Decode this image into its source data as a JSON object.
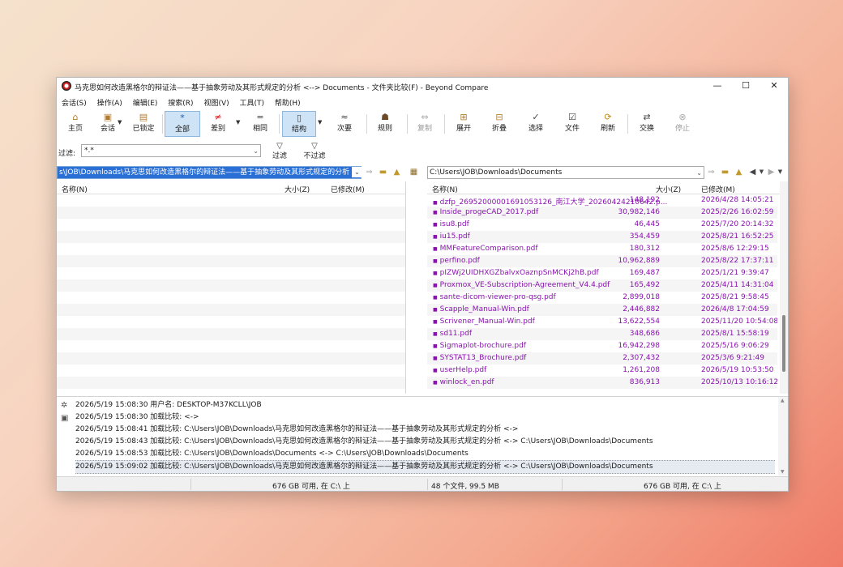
{
  "window": {
    "title": "马克思如何改造黑格尔的辩证法——基于抽象劳动及其形式规定的分析 <--> Documents - 文件夹比较(F) - Beyond Compare",
    "minimize": "—",
    "maximize": "☐",
    "close": "✕"
  },
  "menu": [
    "会话(S)",
    "操作(A)",
    "编辑(E)",
    "搜索(R)",
    "视图(V)",
    "工具(T)",
    "帮助(H)"
  ],
  "toolbar": {
    "home": "主页",
    "sessions": "会话",
    "locked": "已锁定",
    "all": "全部",
    "diffs": "差别",
    "same": "相同",
    "structure": "结构",
    "minor": "次要",
    "rules": "规则",
    "copy": "复制",
    "expand": "展开",
    "collapse": "折叠",
    "select": "选择",
    "files": "文件",
    "refresh": "刷新",
    "swap": "交换",
    "stop": "停止"
  },
  "filter": {
    "label": "过滤:",
    "value": "*.*",
    "filter_btn": "过滤",
    "nofilter_btn": "不过滤"
  },
  "left": {
    "path": "s\\JOB\\Downloads\\马克思如何改造黑格尔的辩证法——基于抽象劳动及其形式规定的分析",
    "col_name": "名称(N)",
    "col_size": "大小(Z)",
    "col_modified": "已修改(M)"
  },
  "right": {
    "path": "C:\\Users\\JOB\\Downloads\\Documents",
    "col_name": "名称(N)",
    "col_size": "大小(Z)",
    "col_modified": "已修改(M)",
    "files": [
      {
        "name": "dzfp_26952000001691053126_南江大学_20260424210642.p...",
        "size": "148,192",
        "date": "2026/4/28 14:05:21"
      },
      {
        "name": "Inside_progeCAD_2017.pdf",
        "size": "30,982,146",
        "date": "2025/2/26 16:02:59"
      },
      {
        "name": "isu8.pdf",
        "size": "46,445",
        "date": "2025/7/20 20:14:32"
      },
      {
        "name": "iu15.pdf",
        "size": "354,459",
        "date": "2025/8/21 16:52:25"
      },
      {
        "name": "MMFeatureComparison.pdf",
        "size": "180,312",
        "date": "2025/8/6 12:29:15"
      },
      {
        "name": "perfino.pdf",
        "size": "10,962,889",
        "date": "2025/8/22 17:37:11"
      },
      {
        "name": "pIZWj2UIDHXGZbalvxOaznpSnMCKj2hB.pdf",
        "size": "169,487",
        "date": "2025/1/21 9:39:47"
      },
      {
        "name": "Proxmox_VE-Subscription-Agreement_V4.4.pdf",
        "size": "165,492",
        "date": "2025/4/11 14:31:04"
      },
      {
        "name": "sante-dicom-viewer-pro-qsg.pdf",
        "size": "2,899,018",
        "date": "2025/8/21 9:58:45"
      },
      {
        "name": "Scapple_Manual-Win.pdf",
        "size": "2,446,882",
        "date": "2026/4/8 17:04:59"
      },
      {
        "name": "Scrivener_Manual-Win.pdf",
        "size": "13,622,554",
        "date": "2025/11/20 10:54:08"
      },
      {
        "name": "sd11.pdf",
        "size": "348,686",
        "date": "2025/8/1 15:58:19"
      },
      {
        "name": "Sigmaplot-brochure.pdf",
        "size": "16,942,298",
        "date": "2025/5/16 9:06:29"
      },
      {
        "name": "SYSTAT13_Brochure.pdf",
        "size": "2,307,432",
        "date": "2025/3/6 9:21:49"
      },
      {
        "name": "userHelp.pdf",
        "size": "1,261,208",
        "date": "2026/5/19 10:53:50"
      },
      {
        "name": "winlock_en.pdf",
        "size": "836,913",
        "date": "2025/10/13 10:16:12"
      }
    ]
  },
  "log": [
    "2026/5/19 15:08:30  用户名:   DESKTOP-M37KCLL\\JOB",
    "2026/5/19 15:08:30  加载比较:   <->",
    "2026/5/19 15:08:41  加载比较:   C:\\Users\\JOB\\Downloads\\马克思如何改造黑格尔的辩证法——基于抽象劳动及其形式规定的分析 <->",
    "2026/5/19 15:08:43  加载比较:   C:\\Users\\JOB\\Downloads\\马克思如何改造黑格尔的辩证法——基于抽象劳动及其形式规定的分析 <-> C:\\Users\\JOB\\Downloads\\Documents",
    "2026/5/19 15:08:53  加载比较:   C:\\Users\\JOB\\Downloads\\Documents <-> C:\\Users\\JOB\\Downloads\\Documents",
    "2026/5/19 15:09:02  加载比较:   C:\\Users\\JOB\\Downloads\\马克思如何改造黑格尔的辩证法——基于抽象劳动及其形式规定的分析 <-> C:\\Users\\JOB\\Downloads\\Documents"
  ],
  "status": {
    "left_free": "676 GB 可用, 在 C:\\ 上",
    "summary": "48 个文件, 99.5 MB",
    "right_free": "676 GB 可用, 在 C:\\ 上"
  },
  "icons": {
    "home": "home-icon",
    "sessions": "briefcase-icon",
    "lock": "lock-icon",
    "all": "asterisk-icon",
    "diff": "not-equal-icon",
    "same": "equal-icon",
    "structure": "structure-icon",
    "minor": "approx-icon",
    "rules": "rules-icon",
    "copy": "copy-icon",
    "expand": "expand-icon",
    "collapse": "collapse-icon",
    "select": "select-icon",
    "files": "files-icon",
    "refresh": "refresh-icon",
    "swap": "swap-icon",
    "stop": "stop-icon"
  },
  "colors": {
    "accent": "#2a6fd6",
    "orphan_file": "#8a12b0"
  }
}
